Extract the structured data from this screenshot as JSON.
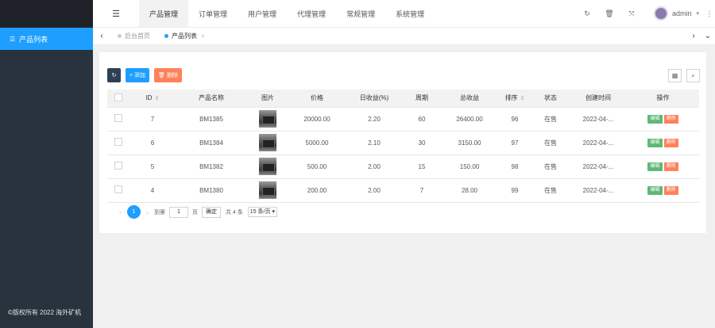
{
  "sidebar": {
    "menu_icon": "list-icon",
    "menu_label": "产品列表",
    "copyright": "©版权所有 2022 海外矿机"
  },
  "topbar": {
    "flex_icon": "menu-fold-icon",
    "nav": [
      "产品管理",
      "订单管理",
      "用户管理",
      "代理管理",
      "常规管理",
      "系统管理"
    ],
    "active_index": 0,
    "icons": [
      "refresh-icon",
      "trash-icon",
      "fullscreen-icon"
    ],
    "user": "admin"
  },
  "tabs": {
    "items": [
      {
        "label": "后台首页",
        "active": false
      },
      {
        "label": "产品列表",
        "active": true
      }
    ]
  },
  "toolbar": {
    "add_label": "+ 添加",
    "delete_label": "删除"
  },
  "table": {
    "headers": [
      "ID",
      "产品名称",
      "图片",
      "价格",
      "日收益(%)",
      "周期",
      "总收益",
      "排序",
      "状态",
      "创建时间",
      "操作"
    ],
    "rows": [
      {
        "id": "7",
        "name": "BM1385",
        "price": "20000.00",
        "daily": "2.20",
        "period": "60",
        "total": "26400.00",
        "sort": "96",
        "status": "在售",
        "created": "2022-04-..."
      },
      {
        "id": "6",
        "name": "BM1384",
        "price": "5000.00",
        "daily": "2.10",
        "period": "30",
        "total": "3150.00",
        "sort": "97",
        "status": "在售",
        "created": "2022-04-..."
      },
      {
        "id": "5",
        "name": "BM1382",
        "price": "500.00",
        "daily": "2.00",
        "period": "15",
        "total": "150.00",
        "sort": "98",
        "status": "在售",
        "created": "2022-04-..."
      },
      {
        "id": "4",
        "name": "BM1380",
        "price": "200.00",
        "daily": "2.00",
        "period": "7",
        "total": "28.00",
        "sort": "99",
        "status": "在售",
        "created": "2022-04-..."
      }
    ],
    "edit_label": "编辑",
    "delete_label": "删除"
  },
  "pager": {
    "current": "1",
    "goto_label": "到第",
    "page_input": "1",
    "page_suffix": "页",
    "confirm": "确定",
    "total": "共 4 条",
    "per_page": "15 条/页"
  }
}
